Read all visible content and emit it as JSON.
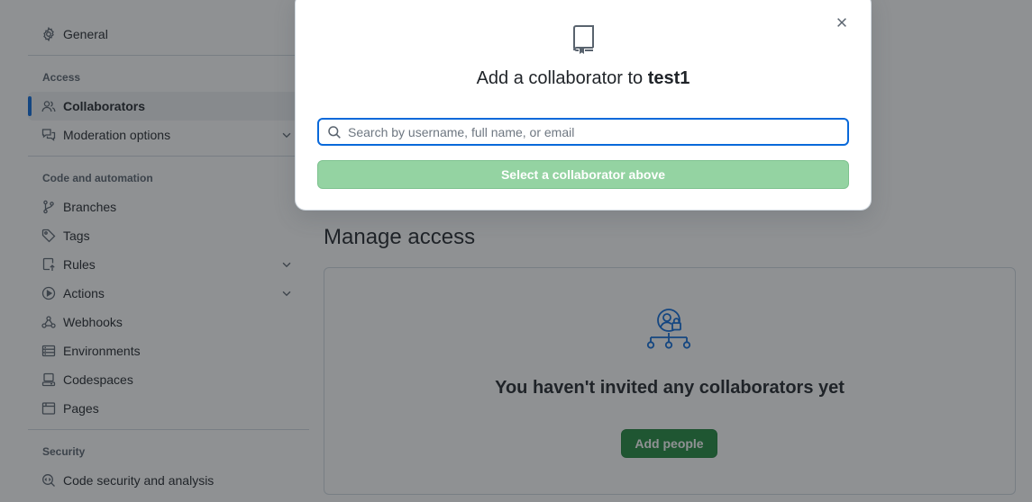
{
  "sidebar": {
    "general": {
      "label": "General",
      "icon": "gear-icon"
    },
    "groups": {
      "access": "Access",
      "code_automation": "Code and automation",
      "security": "Security"
    },
    "access_items": [
      {
        "label": "Collaborators",
        "icon": "people-icon",
        "active": true
      },
      {
        "label": "Moderation options",
        "icon": "comment-discussion-icon",
        "expandable": true
      }
    ],
    "code_items": [
      {
        "label": "Branches",
        "icon": "git-branch-icon"
      },
      {
        "label": "Tags",
        "icon": "tag-icon"
      },
      {
        "label": "Rules",
        "icon": "repo-push-icon",
        "expandable": true
      },
      {
        "label": "Actions",
        "icon": "play-icon",
        "expandable": true
      },
      {
        "label": "Webhooks",
        "icon": "webhook-icon"
      },
      {
        "label": "Environments",
        "icon": "server-icon"
      },
      {
        "label": "Codespaces",
        "icon": "codespaces-icon"
      },
      {
        "label": "Pages",
        "icon": "browser-icon"
      }
    ],
    "security_items": [
      {
        "label": "Code security and analysis",
        "icon": "codescan-icon"
      }
    ]
  },
  "main": {
    "title": "Manage access",
    "empty_message": "You haven't invited any collaborators yet",
    "add_button": "Add people",
    "empty_icon": "people-lock-network-icon"
  },
  "modal": {
    "title_prefix": "Add a collaborator to",
    "repo_name": "test1",
    "search_placeholder": "Search by username, full name, or email",
    "search_value": "",
    "select_button": "Select a collaborator above",
    "close_icon": "x-icon",
    "header_icon": "repo-icon"
  },
  "colors": {
    "accent_blue": "#0969da",
    "primary_green": "#1f883d",
    "disabled_green": "#94d3a2",
    "backdrop": "rgba(31,35,40,0.5)"
  }
}
